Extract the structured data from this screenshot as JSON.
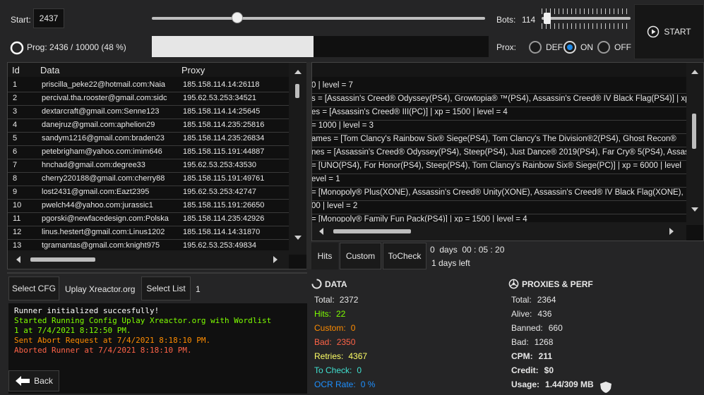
{
  "top": {
    "start_label": "Start:",
    "start_value": "2437",
    "bots_label": "Bots:",
    "bots_value": "114",
    "start_button": "START",
    "progress_label": "Prog: 2436  /  10000  (48 %)",
    "progress_fraction": 0.48,
    "prox_label": "Prox:",
    "prox_options": [
      "DEF",
      "ON",
      "OFF"
    ],
    "prox_selected": "ON"
  },
  "wordlist": {
    "headers": [
      "Id",
      "Data",
      "Proxy"
    ],
    "rows": [
      {
        "id": "1",
        "data": "priscilla_peke22@hotmail.com:Naia",
        "proxy": "185.158.114.14:26118"
      },
      {
        "id": "2",
        "data": "percival.tha.rooster@gmail.com:sidc",
        "proxy": "195.62.53.253:34521"
      },
      {
        "id": "3",
        "data": "dextarcraft@gmail.com:Senne123",
        "proxy": "185.158.114.14:25645"
      },
      {
        "id": "4",
        "data": "danejruz@gmail.com:aphelion29",
        "proxy": "185.158.114.235:25816"
      },
      {
        "id": "5",
        "data": "sandym1216@gmail.com:braden23",
        "proxy": "185.158.114.235:26834"
      },
      {
        "id": "6",
        "data": "petebrigham@yahoo.com:imim646",
        "proxy": "185.158.115.191:44887"
      },
      {
        "id": "7",
        "data": "hnchad@gmail.com:degree33",
        "proxy": "195.62.53.253:43530"
      },
      {
        "id": "8",
        "data": "cherry220188@gmail.com:cherry88",
        "proxy": "185.158.115.191:49761"
      },
      {
        "id": "9",
        "data": "lost2431@gmail.com:Eazt2395",
        "proxy": "195.62.53.253:42747"
      },
      {
        "id": "10",
        "data": "pwelch44@yahoo.com:jurassic1",
        "proxy": "185.158.115.191:26650"
      },
      {
        "id": "11",
        "data": "pgorski@newfacedesign.com:Polska",
        "proxy": "185.158.114.235:42926"
      },
      {
        "id": "12",
        "data": "linus.hestert@gmail.com:Linus1202",
        "proxy": "185.158.114.14:31870"
      },
      {
        "id": "13",
        "data": "tgramantas@gmail.com:knight975",
        "proxy": "195.62.53.253:49834"
      }
    ]
  },
  "captures": [
    "0 | level = 7",
    "s = [Assassin's Creed® Odyssey(PS4), Growtopia® ™(PS4), Assassin's Creed® IV Black Flag(PS4)] | xp",
    "es = [Assassin's Creed® III(PC)] | xp = 1500 | level = 4",
    "= 1000 | level = 3",
    "ames = [Tom Clancy's Rainbow Six® Siege(PS4), Tom Clancy's The Division®2(PS4), Ghost Recon®",
    "nes = [Assassin's Creed® Odyssey(PS4), Steep(PS4), Just Dance® 2019(PS4), Far Cry® 5(PS4), Assas",
    "= [UNO(PS4), For Honor(PS4), Steep(PS4), Tom Clancy's Rainbow Six® Siege(PC)] | xp = 6000 | level",
    "evel = 1",
    "= [Monopoly® Plus(XONE), Assassin's Creed® Unity(XONE), Assassin's Creed® IV Black Flag(XONE),",
    "00 | level = 2",
    "= [Monopoly® Family Fun Pack(PS4)] | xp = 1500 | level = 4"
  ],
  "tabs": {
    "hits": "Hits",
    "custom": "Custom",
    "tocheck": "ToCheck"
  },
  "timer": {
    "elapsed": "0  days  00 : 05 : 20",
    "left": "1 days left"
  },
  "config": {
    "select_cfg": "Select CFG",
    "config_name": "Uplay Xreactor.org",
    "select_list": "Select List",
    "list_value": "1",
    "back": "Back"
  },
  "log": [
    {
      "text": "Runner initialized succesfully!",
      "color": "#ffffff"
    },
    {
      "text": "Started Running Config Uplay Xreactor.org with Wordlist",
      "color": "#7fff00"
    },
    {
      "text": "1 at 7/4/2021 8:12:50 PM.",
      "color": "#7fff00"
    },
    {
      "text": "Sent Abort Request at 7/4/2021 8:18:10 PM.",
      "color": "#ff8c00"
    },
    {
      "text": "Aborted Runner at 7/4/2021 8:18:10 PM.",
      "color": "#ff6347"
    }
  ],
  "data_stats": {
    "title": "DATA",
    "total_label": "Total:",
    "total": "2372",
    "hits_label": "Hits:",
    "hits": "22",
    "custom_label": "Custom:",
    "custom": "0",
    "bad_label": "Bad:",
    "bad": "2350",
    "retries_label": "Retries:",
    "retries": "4367",
    "tocheck_label": "To Check:",
    "tocheck": "0",
    "ocr_label": "OCR Rate:",
    "ocr": "0 %"
  },
  "proxy_stats": {
    "title": "PROXIES & PERF",
    "total_label": "Total:",
    "total": "2364",
    "alive_label": "Alive:",
    "alive": "436",
    "banned_label": "Banned:",
    "banned": "660",
    "bad_label": "Bad:",
    "bad": "1268",
    "cpm_label": "CPM:",
    "cpm": "211",
    "credit_label": "Credit:",
    "credit": "$0",
    "usage_label": "Usage:",
    "usage": "1.44/309 MB"
  },
  "colors": {
    "hits": "#7fff00",
    "custom": "#ff8c00",
    "bad": "#ff6347",
    "retries": "#ffff66",
    "tocheck": "#40e0d0",
    "ocr": "#1e90ff"
  }
}
